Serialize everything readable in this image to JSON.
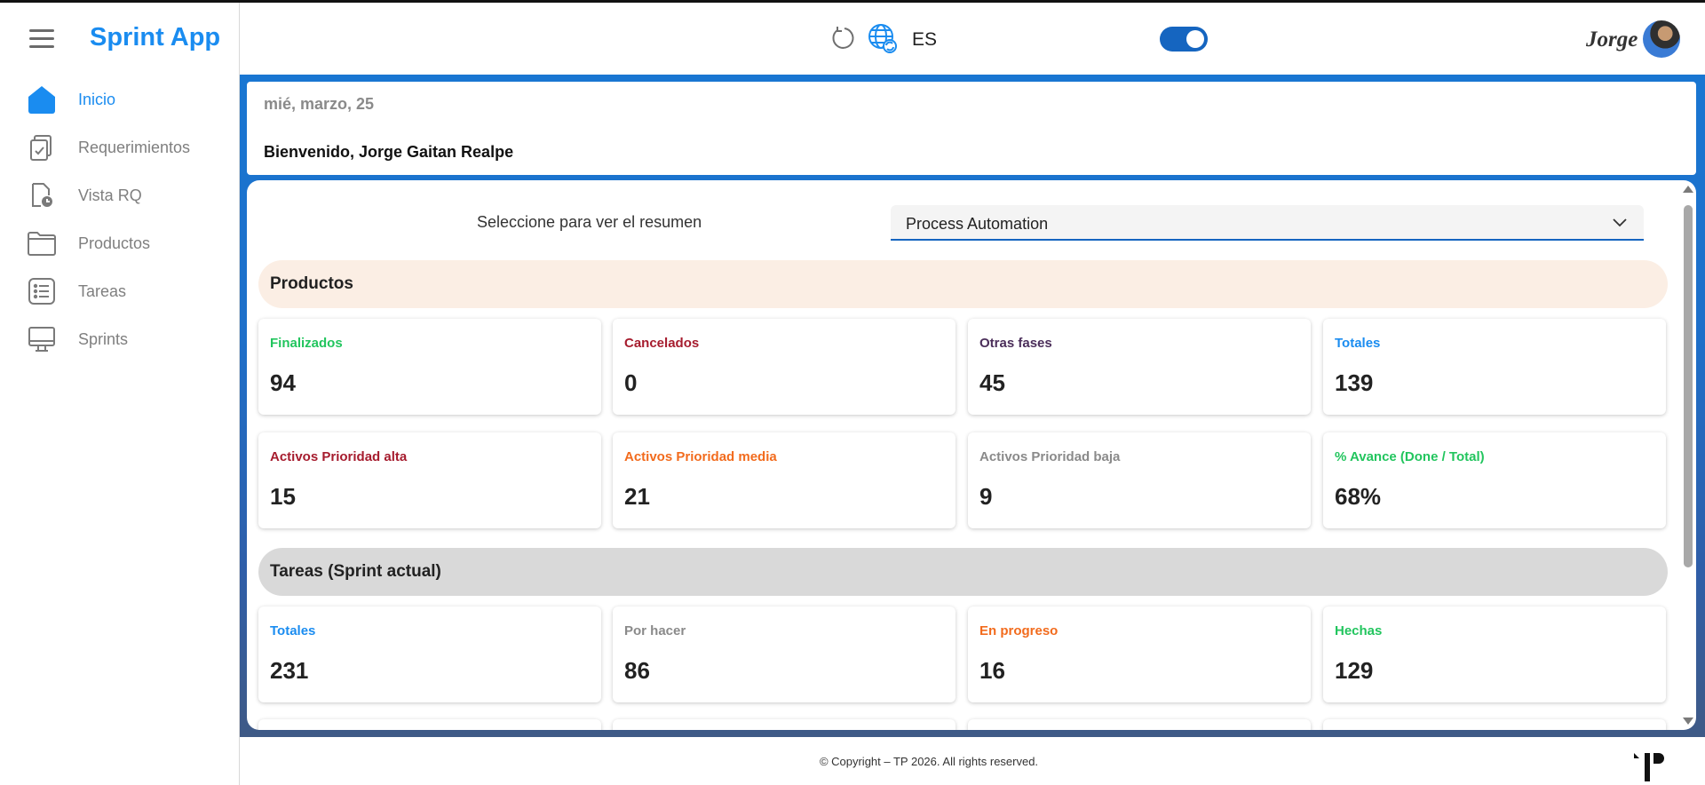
{
  "app": {
    "brand": "Sprint App",
    "language": "ES",
    "user_name": "Jorge"
  },
  "sidebar": {
    "items": [
      {
        "label": "Inicio",
        "icon": "home-icon",
        "active": true
      },
      {
        "label": "Requerimientos",
        "icon": "clipboard-icon",
        "active": false
      },
      {
        "label": "Vista RQ",
        "icon": "document-clock-icon",
        "active": false
      },
      {
        "label": "Productos",
        "icon": "folder-icon",
        "active": false
      },
      {
        "label": "Tareas",
        "icon": "list-icon",
        "active": false
      },
      {
        "label": "Sprints",
        "icon": "monitor-icon",
        "active": false
      }
    ]
  },
  "welcome": {
    "date": "mié, marzo, 25",
    "greeting": "Bienvenido, Jorge Gaitan Realpe"
  },
  "summary": {
    "select_label": "Seleccione para ver el resumen",
    "selected_option": "Process Automation"
  },
  "productos": {
    "title": "Productos",
    "cards": [
      {
        "label": "Finalizados",
        "value": "94",
        "color": "#22c55e"
      },
      {
        "label": "Cancelados",
        "value": "0",
        "color": "#a61c2e"
      },
      {
        "label": "Otras fases",
        "value": "45",
        "color": "#4b2e5a"
      },
      {
        "label": "Totales",
        "value": "139",
        "color": "#1a8cf0"
      },
      {
        "label": "Activos Prioridad alta",
        "value": "15",
        "color": "#a61c2e"
      },
      {
        "label": "Activos Prioridad media",
        "value": "21",
        "color": "#f26b1d"
      },
      {
        "label": "Activos Prioridad baja",
        "value": "9",
        "color": "#8a8a8a"
      },
      {
        "label": "% Avance (Done / Total)",
        "value": "68%",
        "color": "#22c55e"
      }
    ]
  },
  "tareas": {
    "title": "Tareas (Sprint actual)",
    "cards": [
      {
        "label": "Totales",
        "value": "231",
        "color": "#1a8cf0"
      },
      {
        "label": "Por hacer",
        "value": "86",
        "color": "#8a8a8a"
      },
      {
        "label": "En progreso",
        "value": "16",
        "color": "#f26b1d"
      },
      {
        "label": "Hechas",
        "value": "129",
        "color": "#22c55e"
      }
    ]
  },
  "footer": {
    "copyright": "© Copyright – TP 2026. All rights reserved."
  }
}
